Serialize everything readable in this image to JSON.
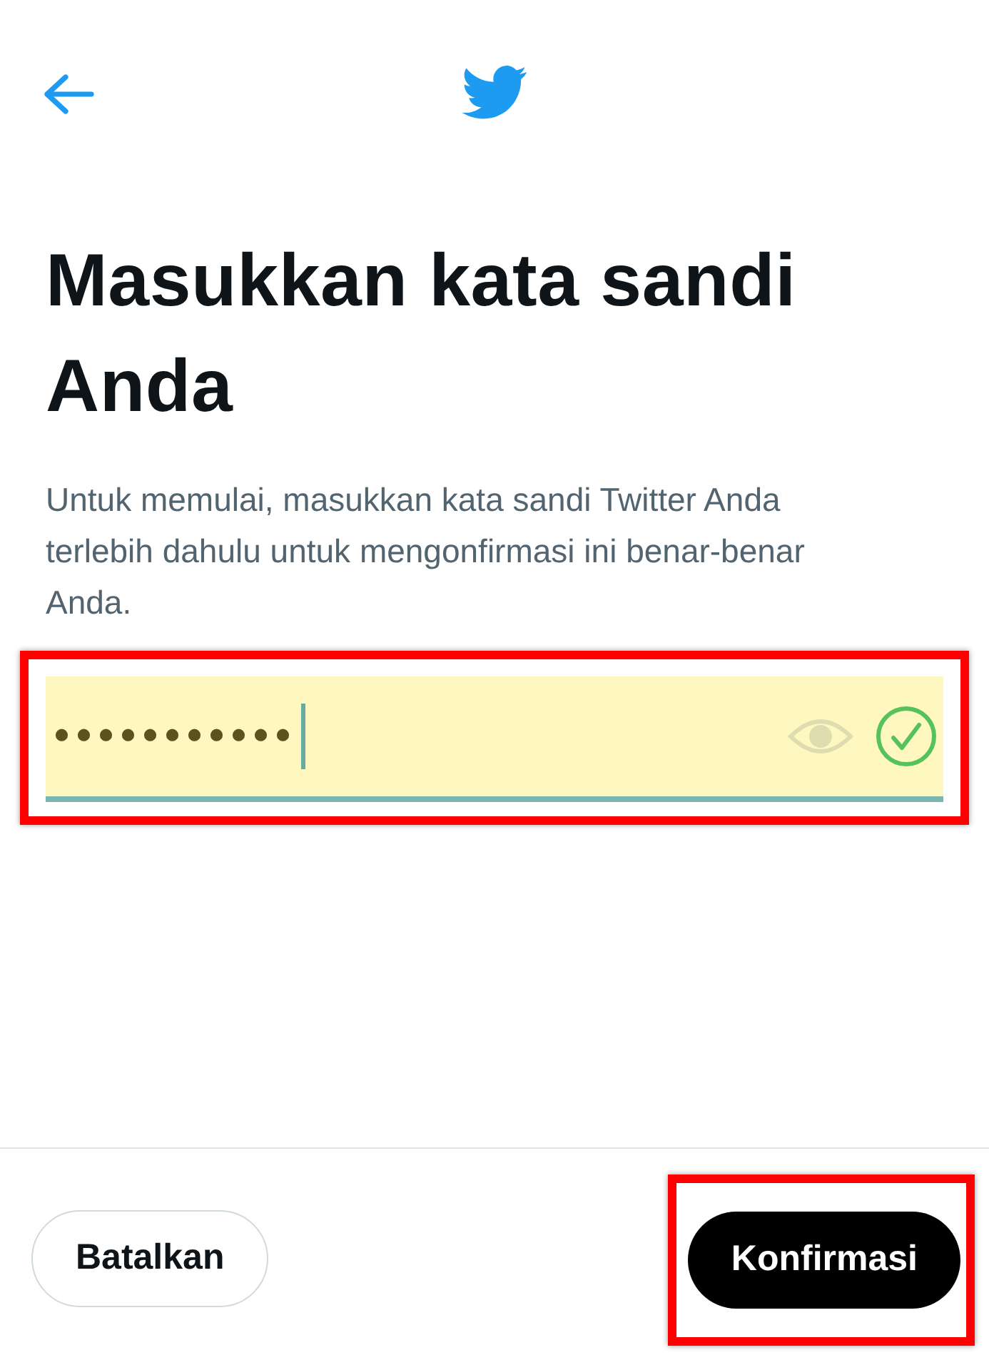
{
  "title": "Masukkan kata sandi Anda",
  "description": "Untuk memulai, masukkan kata sandi Twitter Anda terlebih dahulu untuk mengonfirmasi ini benar-benar Anda.",
  "password_field": {
    "value": "•••••••••••",
    "autofilled": true,
    "valid": true,
    "highlighted": true
  },
  "buttons": [
    {
      "label": "Batalkan",
      "kind": "secondary",
      "highlighted": false
    },
    {
      "label": "Konfirmasi",
      "kind": "primary",
      "highlighted": true
    }
  ]
}
